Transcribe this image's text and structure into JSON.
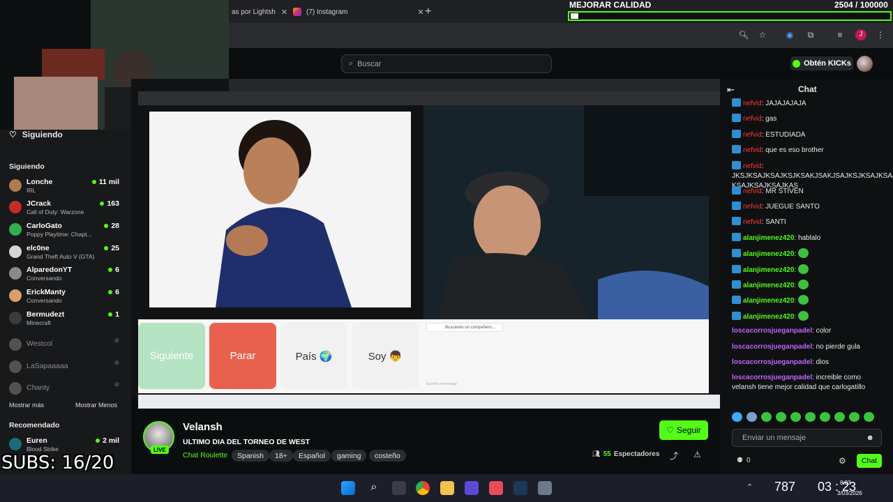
{
  "browser": {
    "tabs": [
      {
        "label": "as por Lightsh"
      },
      {
        "label": "(7) Instagram"
      }
    ],
    "new_tab": "+"
  },
  "goal": {
    "label": "MEJORAR CALIDAD",
    "current": "2504 / 100000",
    "progress": 0.025
  },
  "search": {
    "placeholder": "Buscar"
  },
  "header": {
    "kicks_button": "Obtén KICKs"
  },
  "sidebar": {
    "following_header": "Siguiendo",
    "section_title": "Siguiendo",
    "items": [
      {
        "name": "Lonche",
        "category": "IRL",
        "viewers": "11 mil",
        "live": true,
        "color": "#b07a4a"
      },
      {
        "name": "JCrack",
        "category": "Call of Duty: Warzone",
        "viewers": "163",
        "live": true,
        "color": "#c72a2a"
      },
      {
        "name": "CarloGato",
        "category": "Poppy Playtime: Chapt...",
        "viewers": "28",
        "live": true,
        "color": "#2fae4f"
      },
      {
        "name": "elc0ne",
        "category": "Grand Theft Auto V (GTA)",
        "viewers": "25",
        "live": true,
        "color": "#d4d4d4"
      },
      {
        "name": "AlparedonYT",
        "category": "Conversando",
        "viewers": "6",
        "live": true,
        "color": "#8a8a8a"
      },
      {
        "name": "ErickManty",
        "category": "Conversando",
        "viewers": "6",
        "live": true,
        "color": "#d9a066"
      },
      {
        "name": "Bermudezt",
        "category": "Minecraft",
        "viewers": "1",
        "live": true,
        "color": "#3b3b3b"
      },
      {
        "name": "Westcol",
        "category": "",
        "viewers": "",
        "live": false,
        "color": "#9a9a9a"
      },
      {
        "name": "LaSapaaaaa",
        "category": "",
        "viewers": "",
        "live": false,
        "color": "#9a9a9a"
      },
      {
        "name": "Chanty",
        "category": "",
        "viewers": "",
        "live": false,
        "color": "#9a9a9a"
      }
    ],
    "show_more": "Mostrar más",
    "show_less": "Mostrar Menos",
    "recommended_title": "Recomendado",
    "recommended": [
      {
        "name": "Euren",
        "category": "Blood Strike",
        "viewers": "2 mil"
      }
    ]
  },
  "stream_inner": {
    "searching": "Buscando un compañero...",
    "write_placeholder": "Escribe un mensaje",
    "buttons": [
      "Siguiente",
      "Parar",
      "País 🌍",
      "Soy 👦"
    ]
  },
  "stream_info": {
    "streamer": "Velansh",
    "title": "ULTIMO DIA DEL TORNEO DE WEST",
    "category": "Chat Roulette",
    "tags": [
      "Spanish",
      "18+",
      "Español",
      "gaming",
      "costeño"
    ],
    "live_badge": "LIVE",
    "viewers": "55",
    "viewers_label": "Espectadores",
    "follow_button": "Seguir"
  },
  "chat": {
    "title": "Chat",
    "messages": [
      {
        "user": "nefvid",
        "text": "JAJAJAJAJA",
        "color": "red"
      },
      {
        "user": "nefvid",
        "text": "gas",
        "color": "red"
      },
      {
        "user": "nefvid",
        "text": "ESTUDIADA",
        "color": "red"
      },
      {
        "user": "nefvid",
        "text": "que es eso brother",
        "color": "red"
      },
      {
        "user": "nefvid",
        "text": "JKSJKSAJKSAJKSJKSAKJSAKJSAJKSJKSAJKSAJKSAJ KSAJKSAJKSAJKAS",
        "color": "red"
      },
      {
        "user": "nefvid",
        "text": "MR STIVEN",
        "color": "red"
      },
      {
        "user": "nefvid",
        "text": "JUEGUE SANTO",
        "color": "red"
      },
      {
        "user": "nefvid",
        "text": "SANTI",
        "color": "red"
      },
      {
        "user": "alanjimenez420",
        "text": "hablalo",
        "color": "green"
      },
      {
        "user": "alanjimenez420",
        "text": "",
        "color": "green",
        "emote": true
      },
      {
        "user": "alanjimenez420",
        "text": "",
        "color": "green",
        "emote": true
      },
      {
        "user": "alanjimenez420",
        "text": "",
        "color": "green",
        "emote": true
      },
      {
        "user": "alanjimenez420",
        "text": "",
        "color": "green",
        "emote": true
      },
      {
        "user": "alanjimenez420",
        "text": "",
        "color": "green",
        "emote": true
      },
      {
        "user": "loscacorrosjueganpadel",
        "text": "color",
        "color": "purple"
      },
      {
        "user": "loscacorrosjueganpadel",
        "text": "no pierde gula",
        "color": "purple"
      },
      {
        "user": "loscacorrosjueganpadel",
        "text": "dios",
        "color": "purple"
      },
      {
        "user": "loscacorrosjueganpadel",
        "text": "increible como velansh tiene mejor calidad que carlogatillo",
        "color": "purple"
      }
    ],
    "input_placeholder": "Enviar un mensaje",
    "points": "0",
    "send_button": "Chat"
  },
  "overlay": {
    "subs": "SUBS: 16/20"
  },
  "taskbar": {
    "temp": "787",
    "time": "03 : 23",
    "clock_time": "8:03",
    "clock_date": "3/03/2026"
  },
  "colors": {
    "kick_green": "#53fc18",
    "bg": "#0b0e0f",
    "panel": "#18191b"
  }
}
